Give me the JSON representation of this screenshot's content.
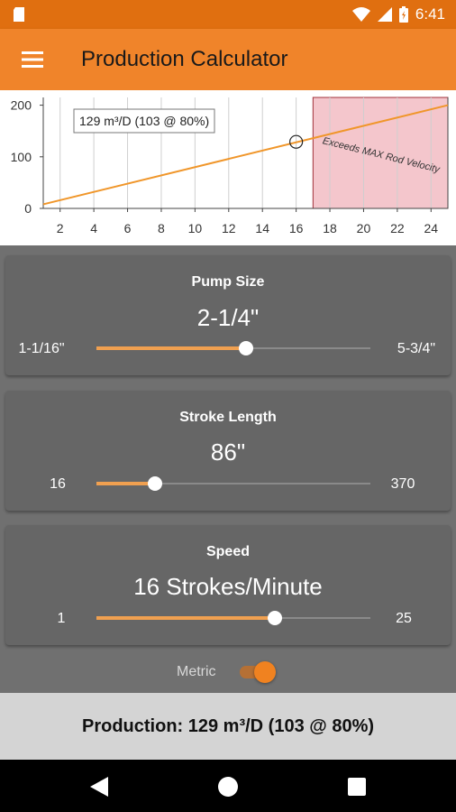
{
  "status_bar": {
    "time": "6:41"
  },
  "app_bar": {
    "title": "Production Calculator"
  },
  "chart": {
    "chart_data": {
      "type": "line",
      "x": [
        0,
        25
      ],
      "y": [
        0,
        200
      ],
      "xlim": [
        1,
        25
      ],
      "ylim": [
        0,
        215
      ],
      "x_ticks": [
        "2",
        "4",
        "6",
        "8",
        "10",
        "12",
        "14",
        "16",
        "18",
        "20",
        "22",
        "24"
      ],
      "y_ticks": [
        "0",
        "100",
        "200"
      ],
      "grid": "vertical",
      "marker": {
        "x": 16,
        "y": 129
      },
      "exceed_region_start": 17,
      "exceed_label": "Exceeds MAX Rod Velocity",
      "legend": "129 m³/D (103 @ 80%)",
      "line_color": "#f0962a",
      "region_color": "#f4c6cc"
    }
  },
  "pump_size": {
    "title": "Pump Size",
    "value": "2-1/4\"",
    "min": "1-1/16\"",
    "max": "5-3/4\"",
    "fraction": 0.545
  },
  "stroke_length": {
    "title": "Stroke Length",
    "value": "86\"",
    "min": "16",
    "max": "370",
    "fraction": 0.215
  },
  "speed": {
    "title": "Speed",
    "value": "16 Strokes/Minute",
    "min": "1",
    "max": "25",
    "fraction": 0.652
  },
  "metric": {
    "label": "Metric",
    "on": true
  },
  "production": {
    "text": "Production: 129 m³/D (103 @ 80%)"
  },
  "colors": {
    "accent": "#f0842a",
    "status_bar": "#e06f10",
    "card": "#666666",
    "background": "#707070"
  }
}
